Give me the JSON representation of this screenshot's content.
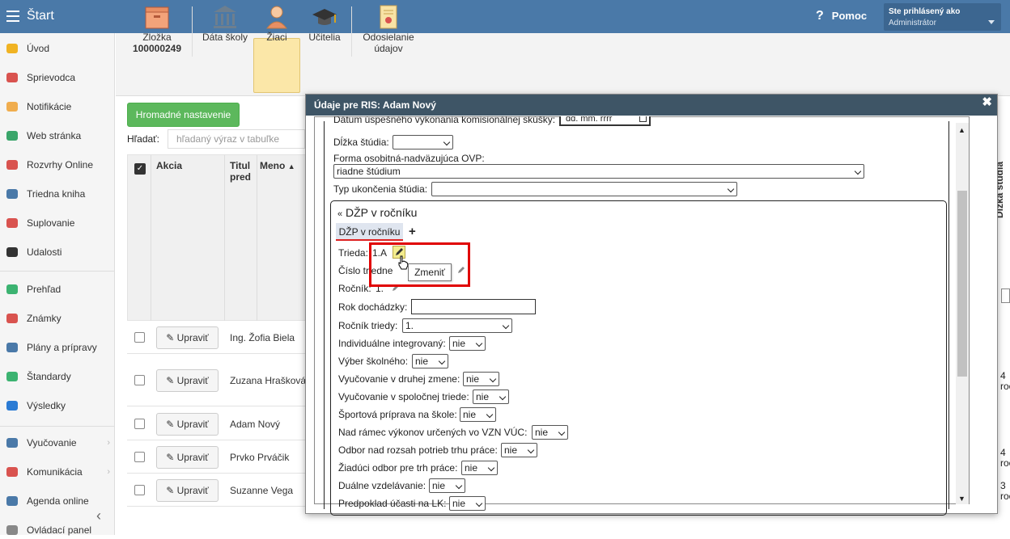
{
  "header": {
    "title": "Štart",
    "help": "Pomoc",
    "user_line1": "Ste prihlásený ako",
    "user_line2": "Administrátor"
  },
  "sidebar": {
    "items": [
      {
        "label": "Úvod",
        "icon": "star-icon"
      },
      {
        "label": "Sprievodca",
        "icon": "wand-icon"
      },
      {
        "label": "Notifikácie",
        "icon": "envelope-icon"
      },
      {
        "label": "Web stránka",
        "icon": "home-icon"
      },
      {
        "label": "Rozvrhy Online",
        "icon": "calendar-icon"
      },
      {
        "label": "Triedna kniha",
        "icon": "book-icon"
      },
      {
        "label": "Suplovanie",
        "icon": "user-icon"
      },
      {
        "label": "Udalosti",
        "icon": "events-icon"
      },
      {
        "label": "Prehľad",
        "icon": "check-circle-icon"
      },
      {
        "label": "Známky",
        "icon": "grade-icon"
      },
      {
        "label": "Plány a prípravy",
        "icon": "briefcase-icon"
      },
      {
        "label": "Štandardy",
        "icon": "shield-icon"
      },
      {
        "label": "Výsledky",
        "icon": "bar-chart-icon"
      },
      {
        "label": "Vyučovanie",
        "icon": "open-book-icon"
      },
      {
        "label": "Komunikácia",
        "icon": "chat-icon"
      },
      {
        "label": "Agenda online",
        "icon": "pen-icon"
      },
      {
        "label": "Ovládací panel",
        "icon": "gear-icon"
      }
    ]
  },
  "toolbar": {
    "zlozka_label": "Zložka",
    "zlozka_number": "100000249",
    "data_skoly": "Dáta školy",
    "ziaci": "Žiaci",
    "ucitelia": "Učitelia",
    "odosielanie1": "Odosielanie",
    "odosielanie2": "údajov"
  },
  "main": {
    "hromadne": "Hromadné nastavenie",
    "hladat_label": "Hľadať:",
    "search_placeholder": "hľadaný výraz v tabuľke",
    "col_akcia": "Akcia",
    "col_titul1": "Titul",
    "col_titul2": "pred",
    "col_meno": "Meno",
    "edit_label": "Upraviť",
    "rows": [
      "Ing. Žofia Biela",
      "Zuzana Hrašková",
      "Adam Nový",
      "Prvko Prváčik",
      "Suzanne Vega"
    ],
    "right_col": "Dĺžka štúdia",
    "right_vals": [
      "4",
      "roč",
      "4",
      "roč",
      "3",
      "roč"
    ]
  },
  "dialog": {
    "title": "Údaje pre RIS: Adam Nový",
    "date_field_label": "Dátum úspešného vykonania komisionálnej skúšky:",
    "date_placeholder": "dd. mm. rrrr",
    "dlzka": "Dĺžka štúdia:",
    "forma": "Forma osobitná-nadväzujúca OVP:",
    "forma_value": "riadne štúdium",
    "typ": "Typ ukončenia štúdia:",
    "section": "DŽP v ročníku",
    "tab": "DŽP v ročníku",
    "trieda": "Trieda:",
    "trieda_value": "1.A",
    "cislo": "Číslo triedne",
    "rocnik": "Ročník:",
    "rocnik_value": "1.",
    "tooltip": "Zmeniť",
    "rok": "Rok dochádzky:",
    "rocnik_triedy": "Ročník triedy:",
    "rocnik_triedy_value": "1.",
    "fields": [
      {
        "label": "Individuálne integrovaný:",
        "value": "nie"
      },
      {
        "label": "Výber školného:",
        "value": "nie"
      },
      {
        "label": "Vyučovanie v druhej zmene:",
        "value": "nie"
      },
      {
        "label": "Vyučovanie v spoločnej triede:",
        "value": "nie"
      },
      {
        "label": "Športová príprava na škole:",
        "value": "nie"
      },
      {
        "label": "Nad rámec výkonov určených vo VZN VÚC:",
        "value": "nie"
      },
      {
        "label": "Odbor nad rozsah potrieb trhu práce:",
        "value": "nie"
      },
      {
        "label": "Žiadúci odbor pre trh práce:",
        "value": "nie"
      },
      {
        "label": "Duálne vzdelávanie:",
        "value": "nie"
      },
      {
        "label": "Predpoklad účasti na LK:",
        "value": "nie"
      }
    ]
  }
}
